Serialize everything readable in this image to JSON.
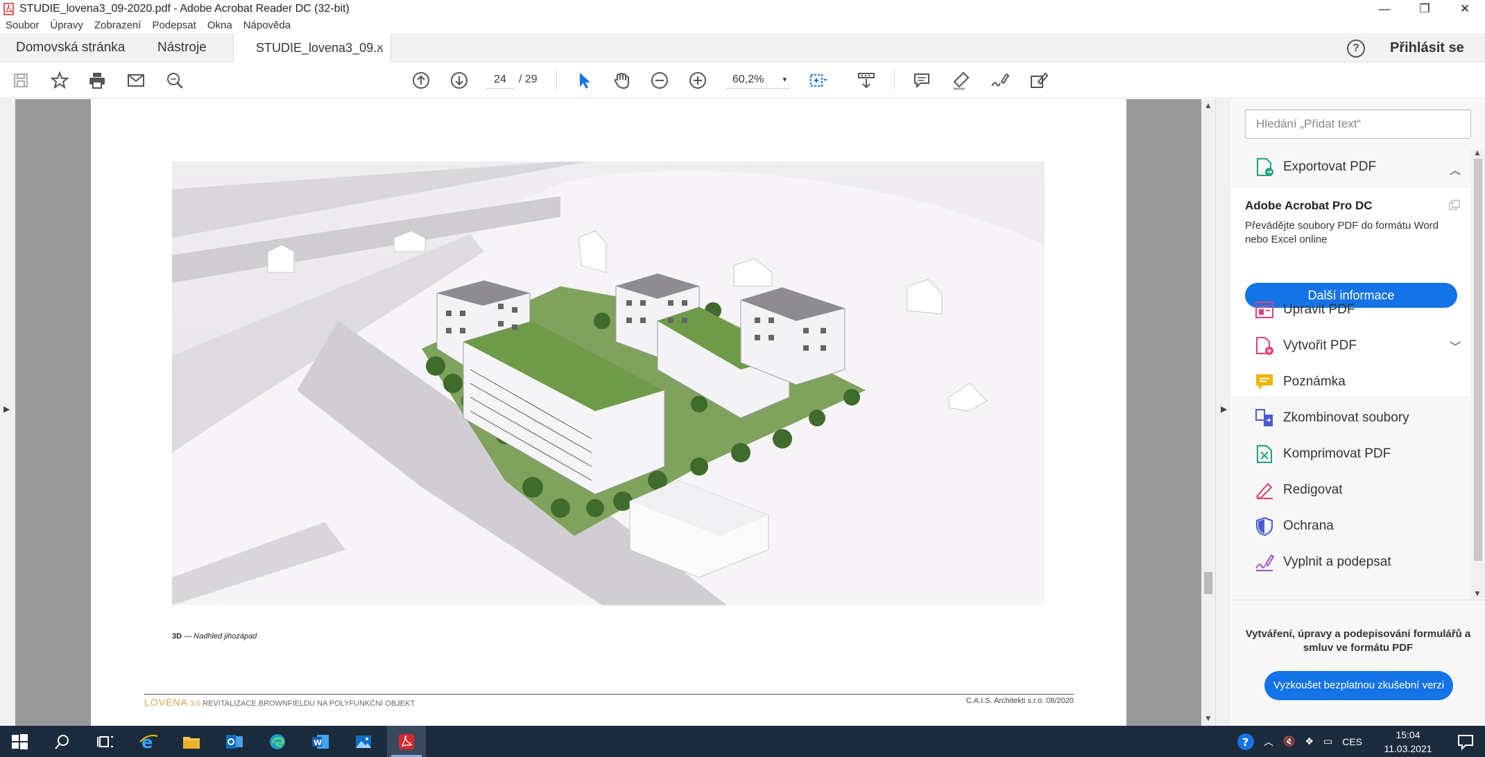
{
  "window": {
    "title": "STUDIE_lovena3_09-2020.pdf - Adobe Acrobat Reader DC (32-bit)",
    "minimize": "—",
    "maximize": "❐",
    "close": "✕"
  },
  "menu": [
    "Soubor",
    "Úpravy",
    "Zobrazení",
    "Podepsat",
    "Okna",
    "Nápověda"
  ],
  "tabs": {
    "home": "Domovská stránka",
    "tools": "Nástroje",
    "document": "STUDIE_lovena3_09...",
    "close": "×",
    "help": "?",
    "signin": "Přihlásit se"
  },
  "toolbar": {
    "page_current": "24",
    "page_total": "/ 29",
    "zoom": "60,2%",
    "zoom_caret": "▾"
  },
  "document": {
    "caption_bold": "3D",
    "caption_rest": " — Nadhled jihozápad",
    "footer_brand_1": "LOVENA",
    "footer_brand_2": "3.0",
    "footer_subtitle": "REVITALIZACE BROWNFIELDU NA POLYFUNKČNÍ OBJEKT",
    "footer_right": "C.A.I.S. Architekti s.r.o.  08/2020"
  },
  "right_pane": {
    "search_placeholder": "Hledání „Přidat text“",
    "export_label": "Exportovat PDF",
    "promo_title": "Adobe Acrobat Pro DC",
    "promo_desc": "Převádějte soubory PDF do formátu Word nebo Excel online",
    "promo_button": "Další informace",
    "tools": [
      {
        "label": "Upravit PDF",
        "icon": "edit-pdf-icon",
        "color": "#e0407a"
      },
      {
        "label": "Vytvořit PDF",
        "icon": "create-pdf-icon",
        "color": "#e0407a"
      },
      {
        "label": "Poznámka",
        "icon": "comment-icon",
        "color": "#f0b400"
      },
      {
        "label": "Zkombinovat soubory",
        "icon": "combine-icon",
        "color": "#4b5bd6"
      },
      {
        "label": "Komprimovat PDF",
        "icon": "compress-icon",
        "color": "#1aa37a"
      },
      {
        "label": "Redigovat",
        "icon": "redact-icon",
        "color": "#e0407a"
      },
      {
        "label": "Ochrana",
        "icon": "protect-icon",
        "color": "#4b5bd6"
      },
      {
        "label": "Vyplnit a podepsat",
        "icon": "fill-sign-icon",
        "color": "#9b4fd6"
      }
    ],
    "trial_text": "Vytváření, úpravy a podepisování formulářů a smluv ve formátu PDF",
    "trial_button": "Vyzkoušet bezplatnou zkušební verzi"
  },
  "taskbar": {
    "lang": "CES",
    "time": "15:04",
    "date": "11.03.2021"
  },
  "colors": {
    "accent": "#1473e6",
    "taskbar": "#1c2b3c",
    "acrobat_red": "#d7282f"
  }
}
